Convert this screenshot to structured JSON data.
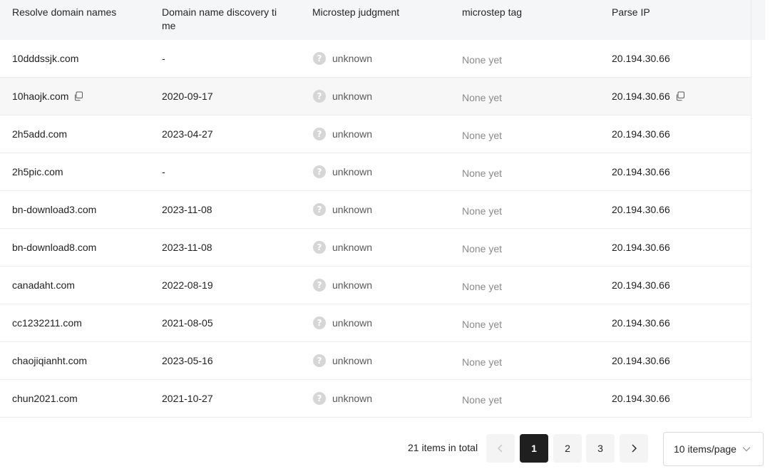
{
  "table": {
    "columns": [
      "Resolve domain names",
      "Domain name discovery ti me",
      "Microstep judgment",
      "microstep tag",
      "Parse IP"
    ],
    "rows": [
      {
        "domain": "10dddssjk.com",
        "date": "-",
        "judgment": "unknown",
        "tag": "None yet",
        "ip": "20.194.30.66"
      },
      {
        "domain": "10haojk.com",
        "date": "2020-09-17",
        "judgment": "unknown",
        "tag": "None yet",
        "ip": "20.194.30.66"
      },
      {
        "domain": "2h5add.com",
        "date": "2023-04-27",
        "judgment": "unknown",
        "tag": "None yet",
        "ip": "20.194.30.66"
      },
      {
        "domain": "2h5pic.com",
        "date": "-",
        "judgment": "unknown",
        "tag": "None yet",
        "ip": "20.194.30.66"
      },
      {
        "domain": "bn-download3.com",
        "date": "2023-11-08",
        "judgment": "unknown",
        "tag": "None yet",
        "ip": "20.194.30.66"
      },
      {
        "domain": "bn-download8.com",
        "date": "2023-11-08",
        "judgment": "unknown",
        "tag": "None yet",
        "ip": "20.194.30.66"
      },
      {
        "domain": "canadaht.com",
        "date": "2022-08-19",
        "judgment": "unknown",
        "tag": "None yet",
        "ip": "20.194.30.66"
      },
      {
        "domain": "cc1232211.com",
        "date": "2021-08-05",
        "judgment": "unknown",
        "tag": "None yet",
        "ip": "20.194.30.66"
      },
      {
        "domain": "chaojiqianht.com",
        "date": "2023-05-16",
        "judgment": "unknown",
        "tag": "None yet",
        "ip": "20.194.30.66"
      },
      {
        "domain": "chun2021.com",
        "date": "2021-10-27",
        "judgment": "unknown",
        "tag": "None yet",
        "ip": "20.194.30.66"
      }
    ],
    "hovered_row": 1,
    "judgment_icon": "question-circle-icon",
    "copy_icon": "copy-icon"
  },
  "pagination": {
    "total_label": "21 items in total",
    "prev_icon": "chevron-left-icon",
    "next_icon": "chevron-right-icon",
    "pages": [
      "1",
      "2",
      "3"
    ],
    "current_page": "1",
    "page_size_label": "10 items/page",
    "page_size_icon": "chevron-down-icon"
  },
  "colors": {
    "header_bg": "#f5f6f8",
    "active_page_bg": "#1f1f1f",
    "icon_gray": "#d6d6d6",
    "muted_text": "#8a8a8a"
  }
}
